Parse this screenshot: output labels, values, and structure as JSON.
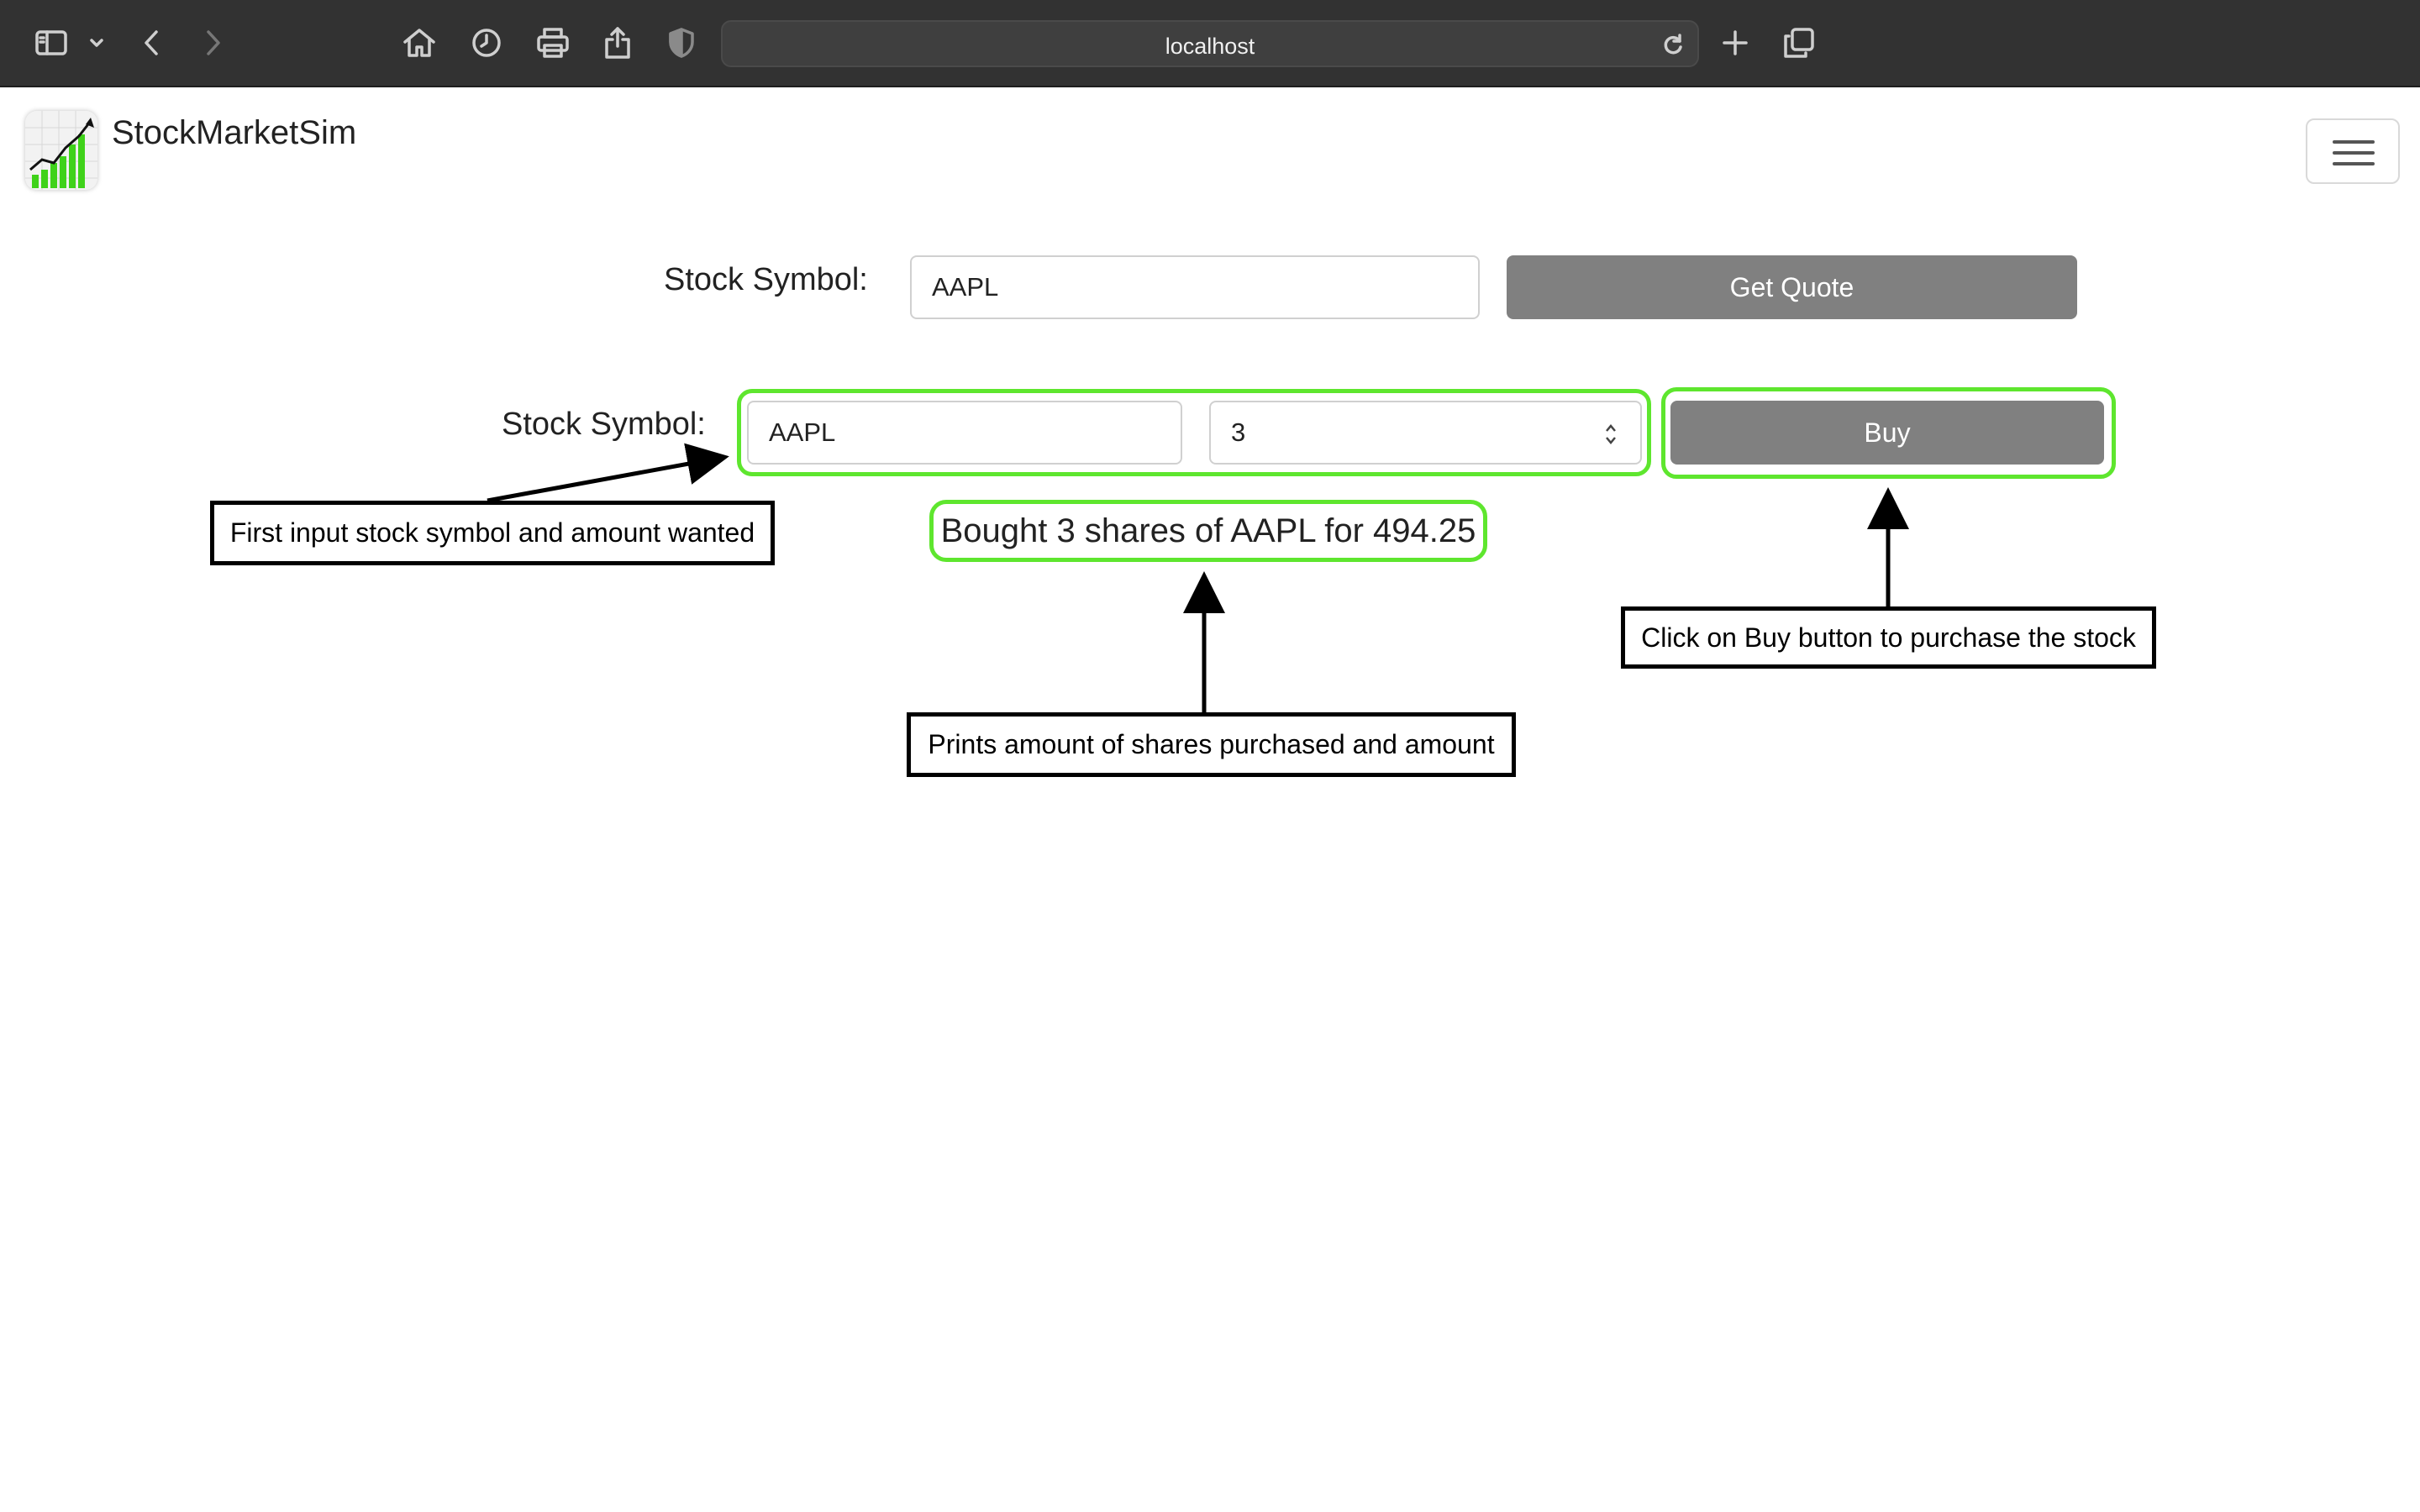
{
  "browser": {
    "address": "localhost",
    "icons": [
      "sidebar-icon",
      "chevron-down-icon",
      "back-icon",
      "forward-icon",
      "home-icon",
      "history-icon",
      "print-icon",
      "share-icon",
      "shield-icon",
      "reload-icon",
      "new-tab-icon",
      "tabs-overview-icon"
    ]
  },
  "navbar": {
    "brand": "StockMarketSim",
    "logo_icon": "stock-chart-logo",
    "menu_icon": "hamburger-menu-icon"
  },
  "quote_form": {
    "label": "Stock Symbol:",
    "symbol_value": "AAPL",
    "button_label": "Get Quote"
  },
  "buy_form": {
    "label": "Stock Symbol:",
    "symbol_value": "AAPL",
    "amount_value": "3",
    "button_label": "Buy"
  },
  "result_message": "Bought 3 shares of AAPL for 494.25",
  "annotations": {
    "input_note": "First input stock symbol and amount wanted",
    "result_note": "Prints amount of shares purchased and amount",
    "buy_note": "Click on Buy button to purchase the stock"
  },
  "colors": {
    "highlight": "#5ee62e",
    "button": "#808080",
    "chrome": "#323232"
  }
}
